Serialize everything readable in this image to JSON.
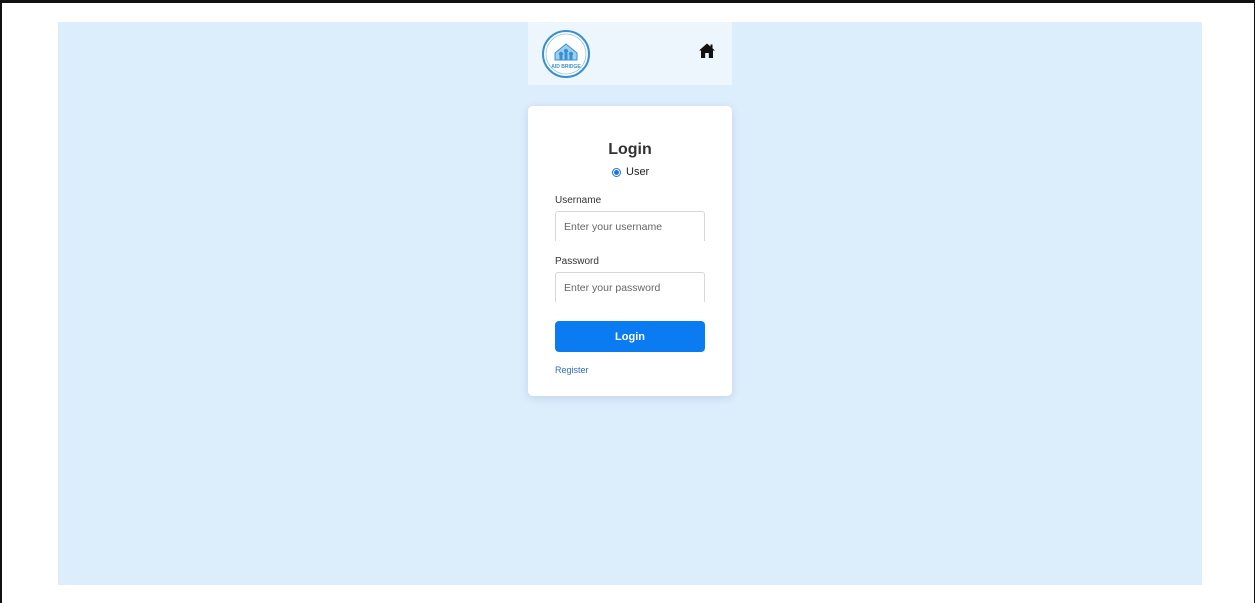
{
  "header": {
    "logo_text": "AID BRIDGE",
    "home_icon": "home-icon"
  },
  "login": {
    "title": "Login",
    "role_option": "User",
    "username_label": "Username",
    "username_placeholder": "Enter your username",
    "password_label": "Password",
    "password_placeholder": "Enter your password",
    "submit_label": "Login",
    "register_link": "Register"
  },
  "colors": {
    "background": "#dcedfc",
    "header_bg": "#eef6fd",
    "primary": "#0b7bf1",
    "link": "#2a6fc7"
  }
}
